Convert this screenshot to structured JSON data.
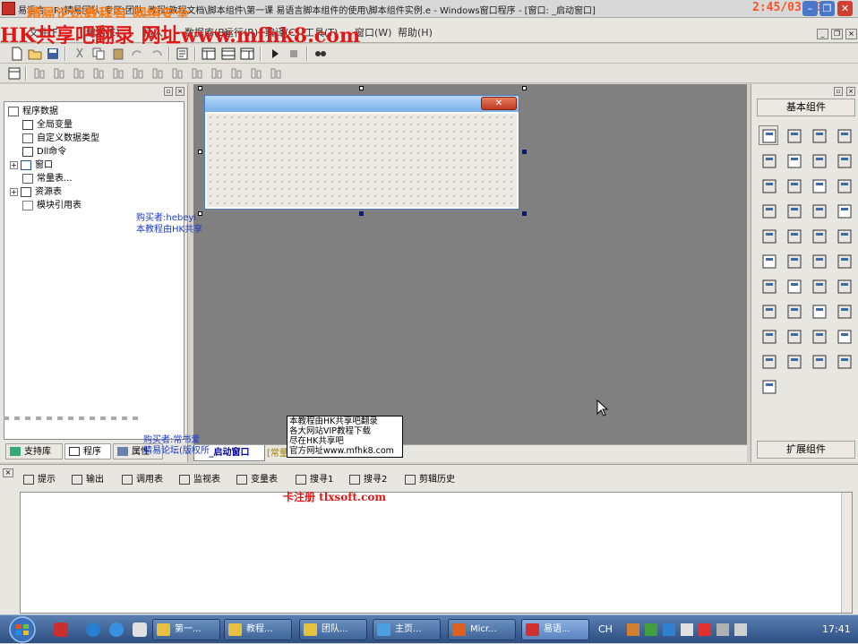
{
  "window": {
    "title": "易语言 - F:\\精易团队_专区\\团队_教程\\教程文档\\脚本组件\\第一课 易语言脚本组件的使用\\脚本组件实例.e - Windows窗口程序 - [窗口: _启动窗口]",
    "clock_overlay": "2:45/03:30"
  },
  "watermarks": {
    "top_orange": "精易论坛教程有 网络安全",
    "top_red": "HK共享吧翻录 网址www.mfhk8.com",
    "bottom_red": "卡注册 tlxsoft.com"
  },
  "menubar": {
    "items": [
      "文件(F)",
      "编辑(E)",
      "插入",
      "数据库(B)",
      "运行(R)",
      "编译(C)",
      "工具(T)",
      "窗口(W)",
      "帮助(H)"
    ]
  },
  "left_panel": {
    "tree": [
      {
        "label": "程序数据",
        "icon": "program-data-icon",
        "expandable": false
      },
      {
        "label": "全局变量",
        "icon": "global-var-icon",
        "expandable": false
      },
      {
        "label": "自定义数据类型",
        "icon": "custom-type-icon",
        "expandable": false
      },
      {
        "label": "Dll命令",
        "icon": "dll-icon",
        "expandable": false
      },
      {
        "label": "窗口",
        "icon": "window-icon",
        "expandable": true
      },
      {
        "label": "常量表...",
        "icon": "constant-icon",
        "expandable": false
      },
      {
        "label": "资源表",
        "icon": "resource-icon",
        "expandable": true
      },
      {
        "label": "模块引用表",
        "icon": "module-icon",
        "expandable": false
      }
    ],
    "tabs": [
      {
        "label": "支持库"
      },
      {
        "label": "程序"
      },
      {
        "label": "属性"
      }
    ]
  },
  "design_notes": {
    "note1_line1": "购买者:hebeyi",
    "note1_line2": "本教程由HK共享",
    "note2_line1": "购买者:常书爱",
    "note2_line2": "精易论坛(版权所"
  },
  "editor_tabs": {
    "active": "_启动窗口",
    "other": "[常量表]"
  },
  "ad_box": {
    "lines": [
      "本教程由HK共享吧翻录",
      "各大网站VIP教程下载",
      "尽在HK共享吧",
      "官方网址www.mfhk8.com"
    ]
  },
  "right_panel": {
    "header": "基本组件",
    "footer": "扩展组件"
  },
  "bottom_panel": {
    "tabs": [
      {
        "label": "提示",
        "icon": "tip-icon"
      },
      {
        "label": "输出",
        "icon": "output-icon"
      },
      {
        "label": "调用表",
        "icon": "call-table-icon"
      },
      {
        "label": "监视表",
        "icon": "watch-icon"
      },
      {
        "label": "变量表",
        "icon": "variable-icon"
      },
      {
        "label": "搜寻1",
        "icon": "search1-icon"
      },
      {
        "label": "搜寻2",
        "icon": "search2-icon"
      },
      {
        "label": "剪辑历史",
        "icon": "clip-history-icon"
      }
    ]
  },
  "taskbar": {
    "buttons": [
      {
        "label": "第一..."
      },
      {
        "label": "教程..."
      },
      {
        "label": "团队..."
      },
      {
        "label": "主页..."
      },
      {
        "label": "Micr..."
      },
      {
        "label": "易语..."
      }
    ],
    "lang": "CH",
    "clock": "17:41",
    "colors": {
      "bar": "#2d4f82",
      "button": "#3f6498"
    }
  }
}
